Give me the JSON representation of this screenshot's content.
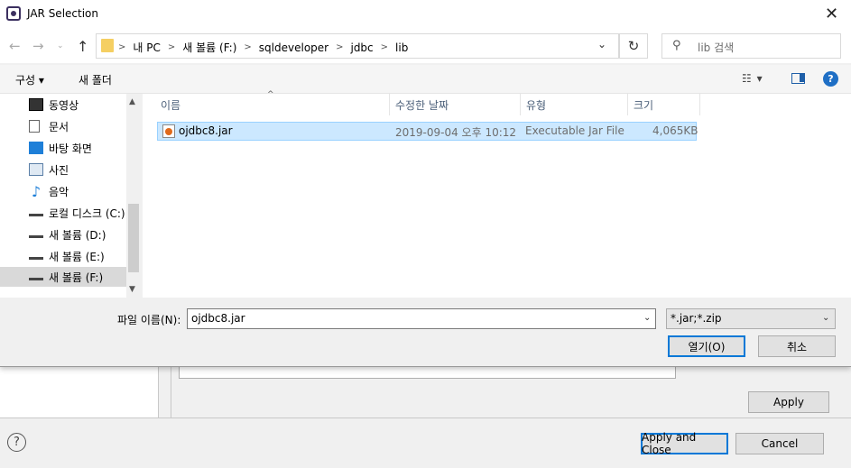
{
  "window": {
    "title": "JAR Selection",
    "close_glyph": "✕"
  },
  "nav": {
    "back_glyph": "←",
    "forward_glyph": "→",
    "history_glyph": "⌄",
    "up_glyph": "↑",
    "breadcrumbs": [
      "내 PC",
      "새 볼륨 (F:)",
      "sqldeveloper",
      "jdbc",
      "lib"
    ],
    "breadcrumb_sep": ">",
    "dropdown_glyph": "⌄",
    "refresh_glyph": "↻",
    "search_icon_glyph": "⚲",
    "search_placeholder": "lib 검색"
  },
  "toolbar": {
    "organize_label": "구성 ▾",
    "new_folder_label": "새 폴더",
    "view_glyph": "☷ ▾",
    "help_glyph": "?"
  },
  "sidebar": {
    "items": [
      {
        "label": "동영상",
        "icon": "film-icon"
      },
      {
        "label": "문서",
        "icon": "document-icon"
      },
      {
        "label": "바탕 화면",
        "icon": "desktop-icon"
      },
      {
        "label": "사진",
        "icon": "pictures-icon"
      },
      {
        "label": "음악",
        "icon": "music-icon"
      },
      {
        "label": "로컬 디스크 (C:)",
        "icon": "drive-icon"
      },
      {
        "label": "새 볼륨 (D:)",
        "icon": "drive-icon"
      },
      {
        "label": "새 볼륨 (E:)",
        "icon": "drive-icon"
      },
      {
        "label": "새 볼륨 (F:)",
        "icon": "drive-icon",
        "selected": true
      }
    ],
    "music_glyph": "♪",
    "scroll_up_glyph": "▲",
    "scroll_down_glyph": "▼"
  },
  "filelist": {
    "columns": [
      "이름",
      "수정한 날짜",
      "유형",
      "크기"
    ],
    "sort_glyph": "^",
    "rows": [
      {
        "name": "ojdbc8.jar",
        "date": "2019-09-04 오후 10:12",
        "type": "Executable Jar File",
        "size": "4,065KB",
        "selected": true
      }
    ]
  },
  "footer": {
    "filename_label": "파일 이름(N):",
    "filename_value": "ojdbc8.jar",
    "filename_dd_glyph": "⌄",
    "filter_value": "*.jar;*.zip",
    "filter_dd_glyph": "⌄",
    "open_label": "열기(O)",
    "cancel_label": "취소"
  },
  "background_dialog": {
    "apply_label": "Apply",
    "apply_close_label": "Apply and Close",
    "cancel_label": "Cancel",
    "help_glyph": "?"
  },
  "colors": {
    "selection": "#cce8ff",
    "accent": "#0078d7"
  }
}
